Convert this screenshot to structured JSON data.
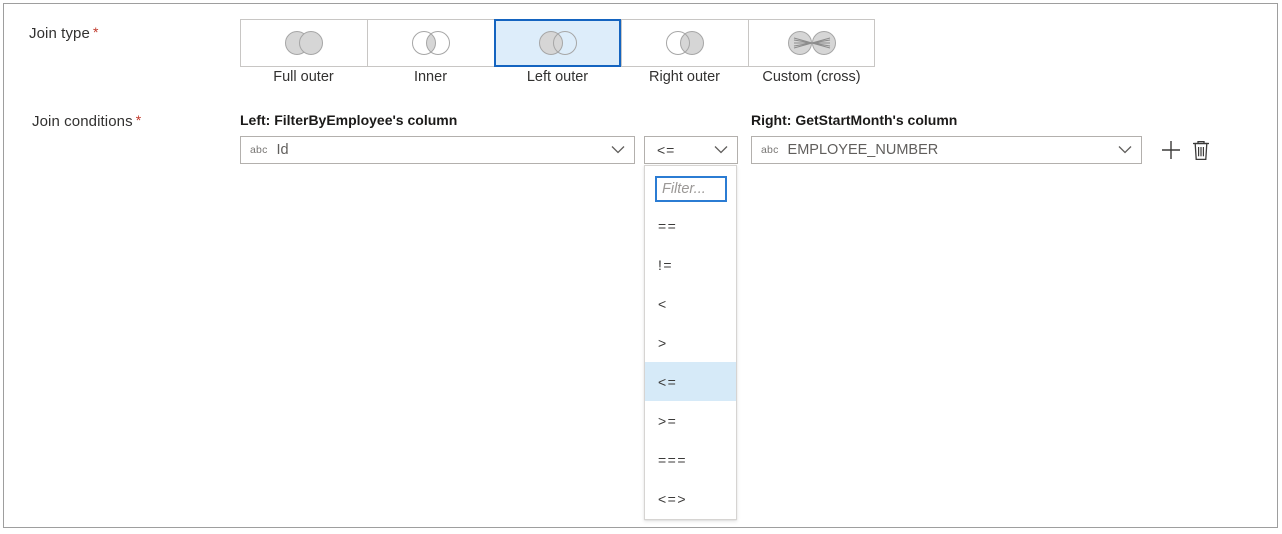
{
  "form": {
    "join_type": {
      "label": "Join type",
      "required_marker": "*",
      "options": [
        {
          "label": "Full outer",
          "icon": "venn-full-outer-icon",
          "selected": false
        },
        {
          "label": "Inner",
          "icon": "venn-inner-icon",
          "selected": false
        },
        {
          "label": "Left outer",
          "icon": "venn-left-outer-icon",
          "selected": true
        },
        {
          "label": "Right outer",
          "icon": "venn-right-outer-icon",
          "selected": false
        },
        {
          "label": "Custom (cross)",
          "icon": "venn-custom-cross-icon",
          "selected": false
        }
      ],
      "selected_value": "Left outer"
    },
    "join_conditions": {
      "label": "Join conditions",
      "required_marker": "*",
      "left_column_title": "Left: FilterByEmployee's column",
      "right_column_title": "Right: GetStartMonth's column",
      "left_column": {
        "type_badge": "abc",
        "value": "Id",
        "chevron": "chevron-down-icon"
      },
      "operator": {
        "value": "<=",
        "chevron": "chevron-down-icon"
      },
      "right_column": {
        "type_badge": "abc",
        "value": "EMPLOYEE_NUMBER",
        "chevron": "chevron-down-icon"
      },
      "actions": {
        "add": {
          "icon": "plus-icon",
          "label": ""
        },
        "delete": {
          "icon": "trash-icon",
          "label": ""
        }
      }
    },
    "operator_dropdown": {
      "open": true,
      "filter_placeholder": "Filter...",
      "filter_value": "",
      "options": [
        "==",
        "!=",
        "<",
        ">",
        "<=",
        ">=",
        "===",
        "<=>"
      ],
      "highlighted_option": "<="
    }
  },
  "colors": {
    "accent_selected_border": "#1464c0",
    "accent_selected_fill": "#ddedfa",
    "highlight_row": "#d6eaf8",
    "required_star": "#c0392b",
    "border": "#c8c6c4",
    "venn_fill": "#d6d6d6",
    "venn_stroke": "#a6a6a6"
  }
}
